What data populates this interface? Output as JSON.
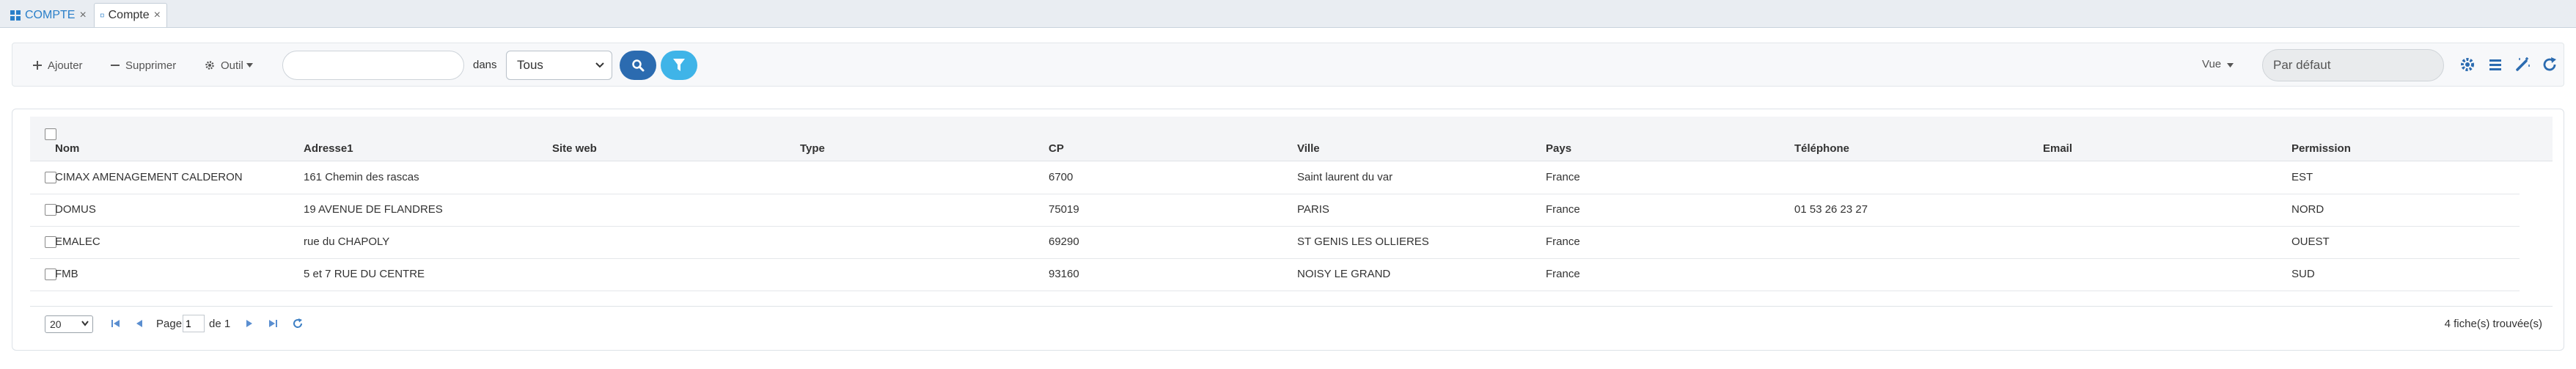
{
  "tabs": [
    {
      "label": "COMPTE",
      "close": "×",
      "active": false
    },
    {
      "label": "Compte",
      "close": "×",
      "active": true
    }
  ],
  "toolbar": {
    "add_label": "Ajouter",
    "delete_label": "Supprimer",
    "tools_label": "Outil",
    "search_value": "",
    "search_placeholder": "",
    "in_label": "dans",
    "scope_selected": "Tous",
    "view_label": "Vue",
    "view_placeholder": "Par défaut"
  },
  "grid": {
    "columns": [
      "Nom",
      "Adresse1",
      "Site web",
      "Type",
      "CP",
      "Ville",
      "Pays",
      "Téléphone",
      "Email",
      "Permission"
    ],
    "rows": [
      [
        "CIMAX AMENAGEMENT CALDERON",
        "161 Chemin des rascas",
        "",
        "",
        "6700",
        "Saint laurent du var",
        "France",
        "",
        "",
        "EST"
      ],
      [
        "DOMUS",
        "19 AVENUE DE FLANDRES",
        "",
        "",
        "75019",
        "PARIS",
        "France",
        "01 53 26 23 27",
        "",
        "NORD"
      ],
      [
        "EMALEC",
        "rue du CHAPOLY",
        "",
        "",
        "69290",
        "ST GENIS LES OLLIERES",
        "France",
        "",
        "",
        "OUEST"
      ],
      [
        "FMB",
        "5 et 7 RUE DU CENTRE",
        "",
        "",
        "93160",
        "NOISY LE GRAND",
        "France",
        "",
        "",
        "SUD"
      ]
    ]
  },
  "pager": {
    "page_size": "20",
    "page_label": "Page",
    "page_value": "1",
    "of_label": "de 1",
    "records_found": "4 fiche(s) trouvée(s)"
  },
  "colors": {
    "accent": "#2a7fc9",
    "search_button": "#2b6bb0",
    "filter_button": "#3fb4e8"
  },
  "icons": {
    "add": "plus-icon",
    "delete": "minus-icon",
    "tools": "gear-icon",
    "search": "search-icon",
    "filter": "filter-icon",
    "settings": "gear-icon",
    "list": "list-icon",
    "magic": "magic-wand-icon",
    "refresh": "refresh-icon"
  }
}
